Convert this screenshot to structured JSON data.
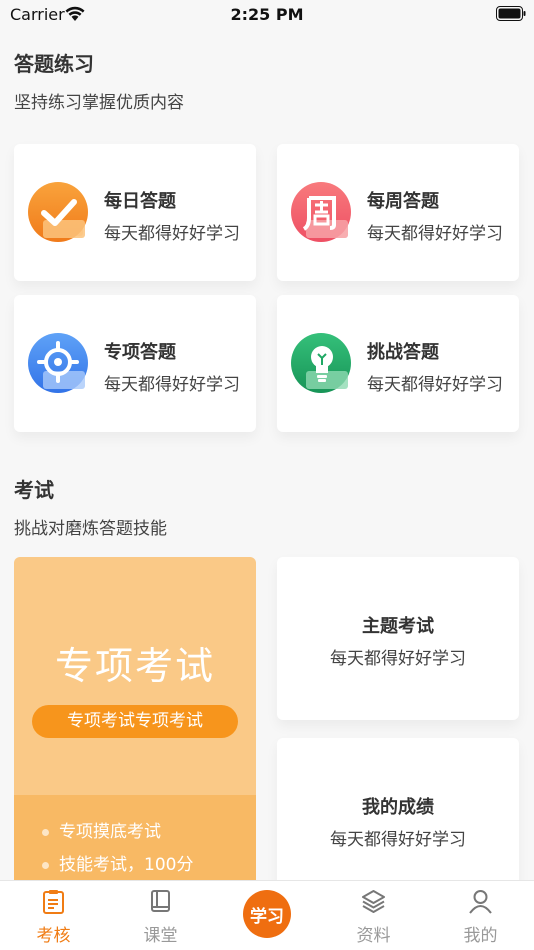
{
  "status": {
    "carrier": "Carrier",
    "time": "2:25 PM"
  },
  "practice": {
    "title": "答题练习",
    "subtitle": "坚持练习掌握优质内容",
    "cards": [
      {
        "title": "每日答题",
        "desc": "每天都得好好学习",
        "icon": "check-icon"
      },
      {
        "title": "每周答题",
        "desc": "每天都得好好学习",
        "icon": "week-icon"
      },
      {
        "title": "专项答题",
        "desc": "每天都得好好学习",
        "icon": "target-icon"
      },
      {
        "title": "挑战答题",
        "desc": "每天都得好好学习",
        "icon": "lightbulb-icon"
      }
    ]
  },
  "exam": {
    "title": "考试",
    "subtitle": "挑战对磨炼答题技能",
    "featured": {
      "title": "专项考试",
      "button": "专项考试专项考试",
      "items": [
        "专项摸底考试",
        "技能考试，100分"
      ]
    },
    "cards": [
      {
        "title": "主题考试",
        "desc": "每天都得好好学习"
      },
      {
        "title": "我的成绩",
        "desc": "每天都得好好学习"
      }
    ]
  },
  "tabbar": {
    "items": [
      {
        "label": "考核",
        "icon": "clipboard-icon",
        "active": true
      },
      {
        "label": "课堂",
        "icon": "book-icon",
        "active": false
      },
      {
        "label": "资料",
        "icon": "layers-icon",
        "active": false
      },
      {
        "label": "我的",
        "icon": "user-icon",
        "active": false
      }
    ],
    "center_glyph": "学习"
  },
  "colors": {
    "accent": "#f07c14",
    "featured_bg": "#fac987"
  }
}
